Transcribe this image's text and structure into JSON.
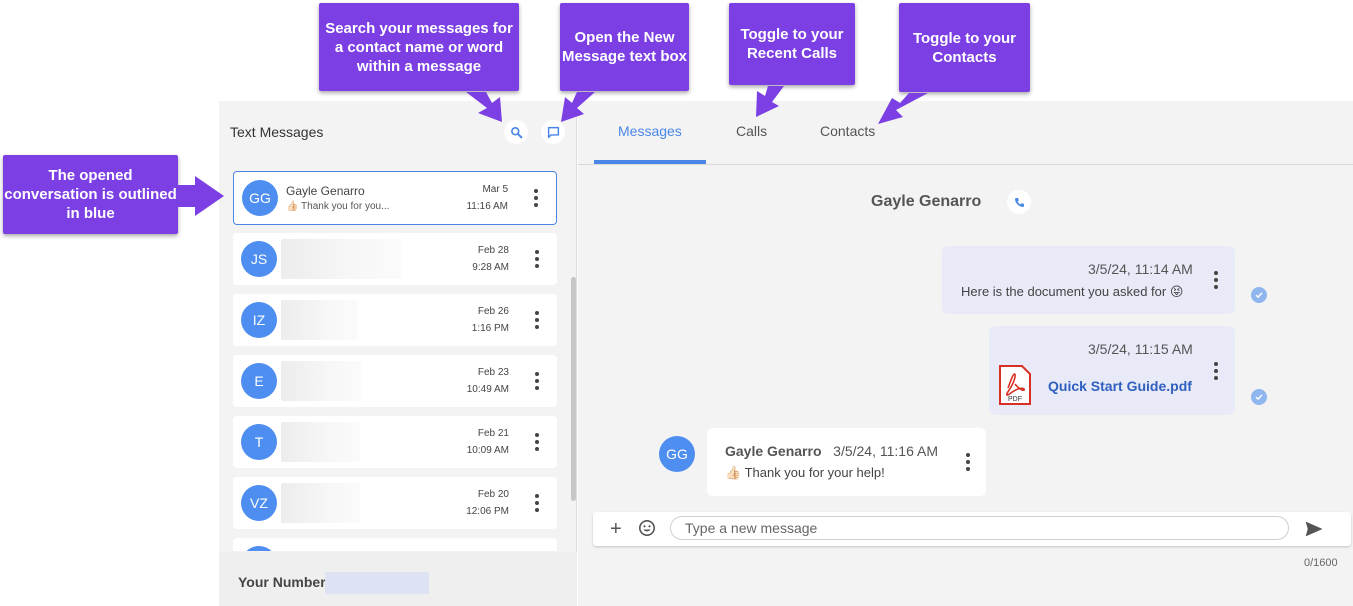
{
  "left": {
    "title": "Text Messages",
    "your_number_label": "Your Number:",
    "conversations": [
      {
        "initials": "GG",
        "name": "Gayle Genarro",
        "preview": "👍🏻 Thank you for you...",
        "date": "Mar 5",
        "time": "11:16 AM",
        "selected": true
      },
      {
        "initials": "JS",
        "name": "",
        "preview": "",
        "date": "Feb 28",
        "time": "9:28 AM"
      },
      {
        "initials": "IZ",
        "name": "",
        "preview": "",
        "date": "Feb 26",
        "time": "1:16 PM"
      },
      {
        "initials": "E",
        "name": "",
        "preview": "",
        "date": "Feb 23",
        "time": "10:49 AM"
      },
      {
        "initials": "T",
        "name": "",
        "preview": "",
        "date": "Feb 21",
        "time": "10:09 AM"
      },
      {
        "initials": "VZ",
        "name": "",
        "preview": "",
        "date": "Feb 20",
        "time": "12:06 PM"
      }
    ]
  },
  "tabs": [
    {
      "label": "Messages",
      "active": true
    },
    {
      "label": "Calls"
    },
    {
      "label": "Contacts"
    }
  ],
  "conversation": {
    "contact_name": "Gayle Genarro",
    "messages": [
      {
        "direction": "out",
        "time": "3/5/24, 11:14 AM",
        "text": "Here is the document you asked for 😝"
      },
      {
        "direction": "out",
        "time": "3/5/24, 11:15 AM",
        "attachment": "Quick Start Guide.pdf",
        "attachment_badge": "PDF"
      },
      {
        "direction": "in",
        "initials": "GG",
        "sender": "Gayle Genarro",
        "time": "3/5/24, 11:16 AM",
        "text": "👍🏻 Thank you for your help!"
      }
    ]
  },
  "composer": {
    "placeholder": "Type a new message",
    "plus_label": "+",
    "char_count": "0/1600"
  },
  "callouts": {
    "search": "Search your messages for a contact name or word within a message",
    "new_message": "Open the New Message text box",
    "calls": "Toggle to your Recent Calls",
    "contacts": "Toggle to your Contacts",
    "opened": "The opened conversation is outlined in blue"
  },
  "colors": {
    "accent": "#4a86e8",
    "avatar": "#4d8ef0",
    "callout": "#7b3fe4",
    "outgoing_bubble": "#e8eaf8",
    "pdf_red": "#d93025"
  }
}
